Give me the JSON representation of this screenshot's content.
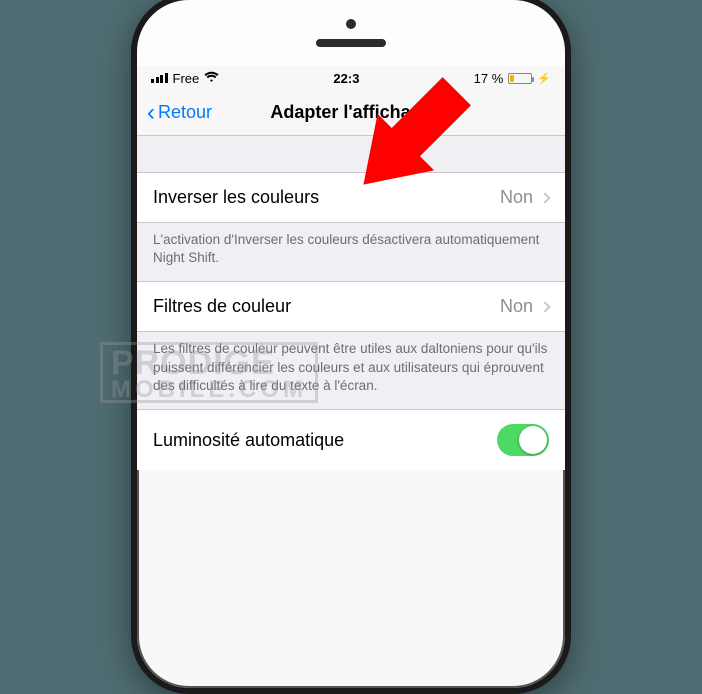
{
  "statusbar": {
    "carrier": "Free",
    "time": "22:3",
    "battery_pct": "17 %"
  },
  "navbar": {
    "back_label": "Retour",
    "title": "Adapter l'affichage"
  },
  "rows": {
    "invert": {
      "label": "Inverser les couleurs",
      "value": "Non"
    },
    "invert_footer": "L'activation d'Inverser les couleurs désactivera automatiquement Night Shift.",
    "filters": {
      "label": "Filtres de couleur",
      "value": "Non"
    },
    "filters_footer": "Les filtres de couleur peuvent être utiles aux daltoniens pour qu'ils puissent différencier les couleurs et aux utilisateurs qui éprouvent des difficultés à lire du texte à l'écran.",
    "auto_brightness": {
      "label": "Luminosité automatique",
      "on": true
    }
  },
  "watermark": {
    "line1": "PRODIGE",
    "line2": "MOBILE.COM"
  }
}
